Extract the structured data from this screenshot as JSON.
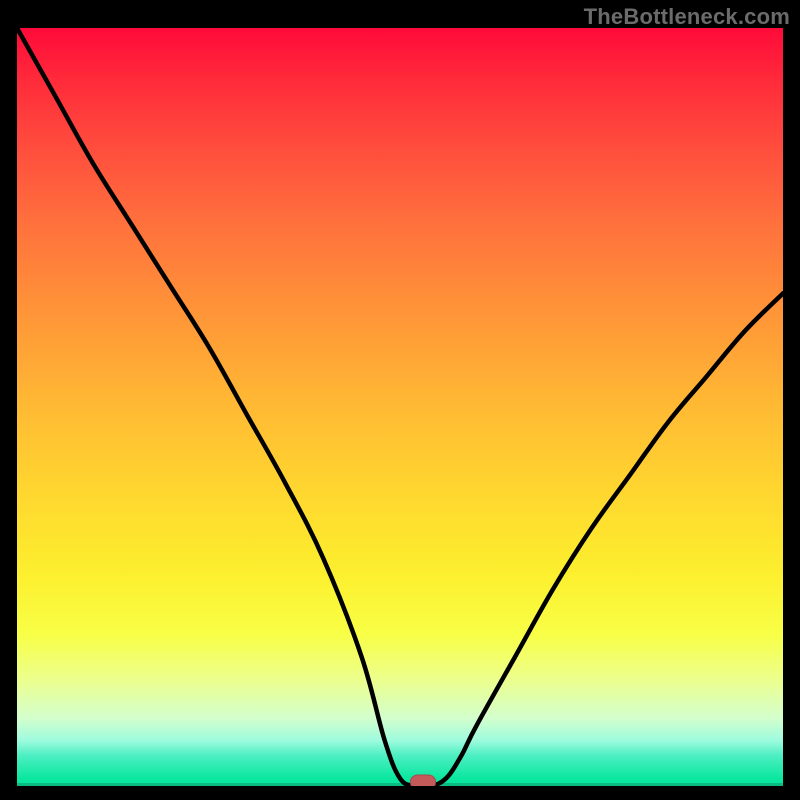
{
  "watermark": "TheBottleneck.com",
  "colors": {
    "curve": "#000000",
    "marker": "#c45a5a",
    "frame": "#000000"
  },
  "chart_data": {
    "type": "line",
    "title": "",
    "xlabel": "",
    "ylabel": "",
    "xlim": [
      0,
      100
    ],
    "ylim": [
      0,
      100
    ],
    "grid": false,
    "legend": false,
    "x": [
      0,
      5,
      10,
      15,
      20,
      25,
      30,
      35,
      40,
      45,
      48,
      50,
      52,
      54,
      56,
      58,
      60,
      65,
      70,
      75,
      80,
      85,
      90,
      95,
      100
    ],
    "values": [
      100,
      91,
      82,
      74,
      66,
      58,
      49,
      40,
      30,
      17,
      6,
      1,
      0,
      0,
      1,
      4,
      8,
      17,
      26,
      34,
      41,
      48,
      54,
      60,
      65
    ],
    "marker": {
      "x": 53,
      "y": 0
    },
    "gradient_interpretation": "red=high bottleneck, green=low bottleneck"
  }
}
